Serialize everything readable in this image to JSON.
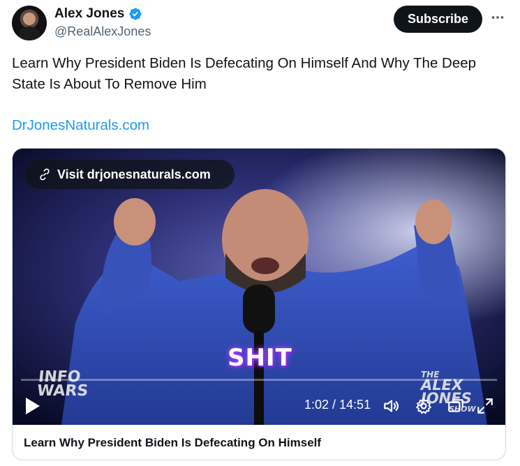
{
  "author": {
    "display_name": "Alex Jones",
    "handle": "@RealAlexJones",
    "verified": true
  },
  "header": {
    "subscribe_label": "Subscribe",
    "more_icon": "more-horizontal-icon"
  },
  "tweet": {
    "text": "Learn Why President Biden Is Defecating On Himself And Why The Deep State Is About To Remove Him",
    "link_text": "DrJonesNaturals.com"
  },
  "video": {
    "visit_label": "Visit drjonesnaturals.com",
    "caption": "SHIT",
    "watermark_left": [
      "INFO",
      "WARS"
    ],
    "watermark_right": [
      "THE",
      "ALEX",
      "JONES",
      "SHOW"
    ],
    "time_display": "1:02 / 14:51",
    "progress_fraction": 0.0,
    "icons": [
      "play-icon",
      "volume-icon",
      "settings-icon",
      "pip-icon",
      "fullscreen-icon"
    ]
  },
  "card": {
    "title": "Learn Why President Biden Is Defecating On Himself"
  },
  "colors": {
    "text": "#0f1419",
    "secondary": "#536471",
    "link": "#1d9bf0",
    "verified": "#1d9bf0",
    "button_bg": "#0f1419",
    "caption_glow": "#a23cff"
  }
}
